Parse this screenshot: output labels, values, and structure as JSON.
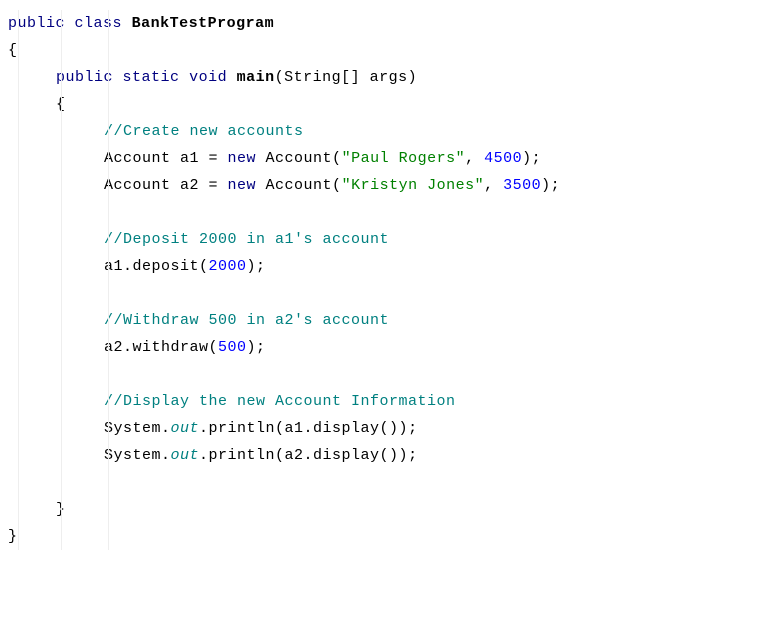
{
  "line1": {
    "a": "public",
    "b": " ",
    "c": "class",
    "d": " ",
    "e": "BankTestProgram"
  },
  "line2": {
    "a": "{"
  },
  "line3": {
    "a": "public",
    "b": " ",
    "c": "static",
    "d": " ",
    "e": "void",
    "f": " ",
    "g": "main",
    "h": "(String[] args)"
  },
  "line4": {
    "a": "{"
  },
  "line5": {
    "a": "//Create new accounts"
  },
  "line6": {
    "a": "Account a1 = ",
    "b": "new",
    "c": " Account(",
    "d": "\"Paul Rogers\"",
    "e": ", ",
    "f": "4500",
    "g": ");"
  },
  "line7": {
    "a": "Account a2 = ",
    "b": "new",
    "c": " Account(",
    "d": "\"Kristyn Jones\"",
    "e": ", ",
    "f": "3500",
    "g": ");"
  },
  "line8": {
    "a": "//Deposit 2000 in a1's account"
  },
  "line9": {
    "a": "a1.deposit(",
    "b": "2000",
    "c": ");"
  },
  "line10": {
    "a": "//Withdraw 500 in a2's account"
  },
  "line11": {
    "a": "a2.withdraw(",
    "b": "500",
    "c": ");"
  },
  "line12": {
    "a": "//Display the new Account Information"
  },
  "line13": {
    "a": "System.",
    "b": "out",
    "c": ".println(a1.display());"
  },
  "line14": {
    "a": "System.",
    "b": "out",
    "c": ".println(a2.display());"
  },
  "line15": {
    "a": "}"
  },
  "line16": {
    "a": "}"
  }
}
